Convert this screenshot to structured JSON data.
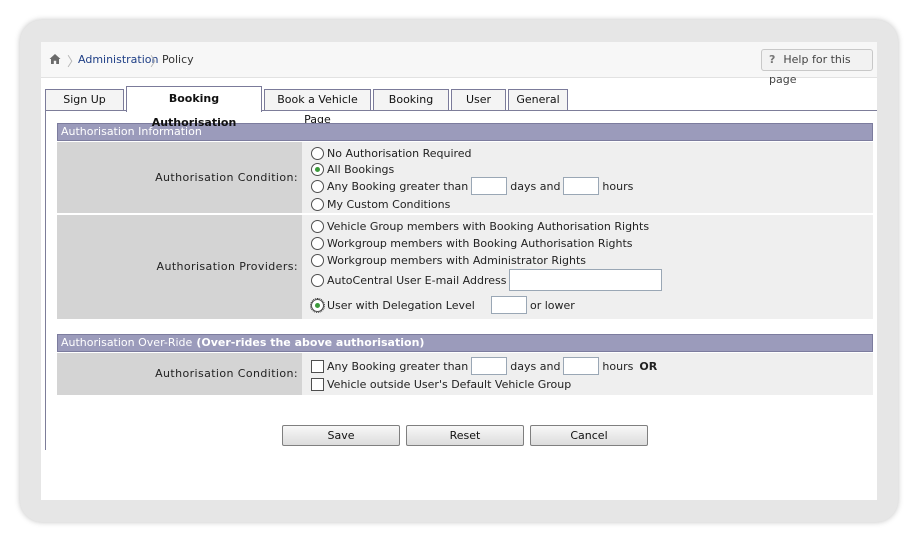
{
  "breadcrumb": {
    "items": [
      "Administration",
      "Policy"
    ]
  },
  "help": {
    "label": "Help for this page",
    "glyph": "?"
  },
  "tabs": [
    {
      "label": "Sign Up"
    },
    {
      "label": "Booking Authorisation"
    },
    {
      "label": "Book a Vehicle Page"
    },
    {
      "label": "Booking"
    },
    {
      "label": "User"
    },
    {
      "label": "General"
    }
  ],
  "active_tab": "Booking Authorisation",
  "auth_info": {
    "title": "Authorisation Information",
    "condition": {
      "label": "Authorisation Condition:",
      "selected": "All Bookings",
      "options": {
        "none": "No Authorisation Required",
        "all": "All Bookings",
        "any_prefix": "Any Booking greater than",
        "any_mid": "days and",
        "any_suffix": "hours",
        "custom": "My Custom Conditions"
      },
      "days": "",
      "hours": ""
    },
    "providers": {
      "label": "Authorisation Providers:",
      "selected": "User with Delegation Level",
      "options": {
        "vg": "Vehicle Group members with Booking Authorisation Rights",
        "wg_booking": "Workgroup members with Booking Authorisation Rights",
        "wg_admin": "Workgroup members with Administrator Rights",
        "email": "AutoCentral User E-mail Address",
        "delegation": "User with Delegation Level",
        "delegation_suffix": "or lower"
      },
      "email_value": "",
      "delegation_value": ""
    }
  },
  "override": {
    "title": "Authorisation Over-Ride",
    "title_note": "(Over-rides the above authorisation)",
    "condition": {
      "label": "Authorisation Condition:",
      "any_prefix": "Any Booking greater than",
      "any_mid": "days and",
      "any_suffix": "hours",
      "or_label": "OR",
      "vehicle_outside": "Vehicle outside User's Default Vehicle Group",
      "any_checked": false,
      "vehicle_checked": false,
      "days": "",
      "hours": ""
    }
  },
  "buttons": {
    "save": "Save",
    "reset": "Reset",
    "cancel": "Cancel"
  },
  "colors": {
    "section_header": "#9b9bbb",
    "link": "#1f3f86",
    "radio_selected": "#3c9a3c"
  }
}
